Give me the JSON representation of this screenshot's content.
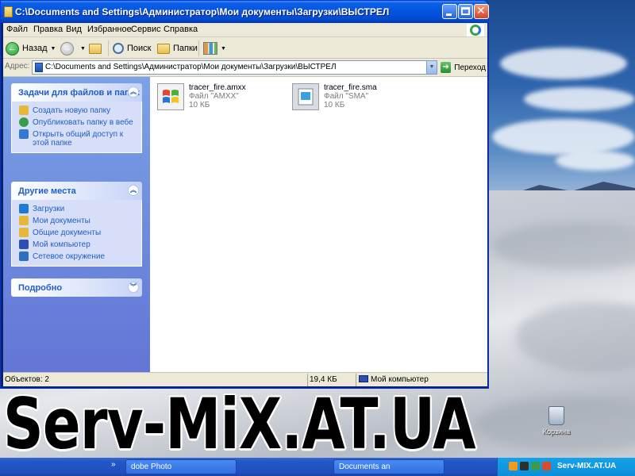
{
  "window": {
    "title": "C:\\Documents and Settings\\Администратор\\Мои документы\\Загрузки\\ВЫСТРЕЛ"
  },
  "menu": {
    "items": [
      "Файл",
      "Правка",
      "Вид",
      "Избранное",
      "Сервис",
      "Справка"
    ]
  },
  "toolbar": {
    "back_label": "Назад",
    "search_label": "Поиск",
    "folders_label": "Папки"
  },
  "address": {
    "label": "Адрес:",
    "value": "C:\\Documents and Settings\\Администратор\\Мои документы\\Загрузки\\ВЫСТРЕЛ",
    "go_label": "Переход"
  },
  "tasks": {
    "title": "Задачи для файлов и папок",
    "items": [
      {
        "label": "Создать новую папку",
        "icon": "new-folder-icon",
        "color": "#e6b83a"
      },
      {
        "label": "Опубликовать папку в вебе",
        "icon": "publish-web-icon",
        "color": "#3a9c4a"
      },
      {
        "label": "Открыть общий доступ к этой папке",
        "icon": "share-folder-icon",
        "color": "#3478d6"
      }
    ]
  },
  "places": {
    "title": "Другие места",
    "items": [
      {
        "label": "Загрузки",
        "icon": "folder-icon",
        "color": "#1f7ad6"
      },
      {
        "label": "Мои документы",
        "icon": "my-documents-icon",
        "color": "#e6b83a"
      },
      {
        "label": "Общие документы",
        "icon": "shared-documents-icon",
        "color": "#e6b83a"
      },
      {
        "label": "Мой компьютер",
        "icon": "my-computer-icon",
        "color": "#2e4fb0"
      },
      {
        "label": "Сетевое окружение",
        "icon": "network-icon",
        "color": "#2e6fc0"
      }
    ]
  },
  "details": {
    "title": "Подробно"
  },
  "files": [
    {
      "name": "tracer_fire.amxx",
      "type": "Файл \"AMXX\"",
      "size": "10 КБ",
      "icon": "windows-file-icon"
    },
    {
      "name": "tracer_fire.sma",
      "type": "Файл \"SMA\"",
      "size": "10 КБ",
      "icon": "sma-file-icon"
    }
  ],
  "status": {
    "objects": "Объектов: 2",
    "size": "19,4 КБ",
    "location": "Мой компьютер"
  },
  "desktop": {
    "recycle_bin_label": "Корзина"
  },
  "taskbar": {
    "chevron": "»",
    "buttons": [
      "dobe Photo",
      "Documents an"
    ],
    "tray_text": "Serv-MIX.AT.UA"
  },
  "watermark": "Serv-MiX.AT.UA",
  "colors": {
    "titlebar": "#0554e0",
    "taskpane": "#7ba2e7",
    "link": "#215dc6"
  }
}
